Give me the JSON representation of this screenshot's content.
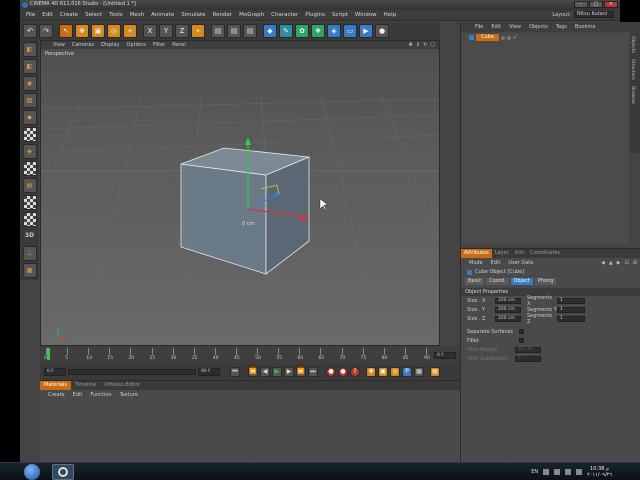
{
  "window": {
    "title": "CINEMA 4D R11.016 Studio - [Untitled 1 *]"
  },
  "menubar": [
    "File",
    "Edit",
    "Create",
    "Select",
    "Tools",
    "Mesh",
    "Animate",
    "Simulate",
    "Render",
    "MoGraph",
    "Character",
    "Plugins",
    "Script",
    "Window",
    "Help"
  ],
  "layout": {
    "label": "Layout:",
    "value": "Nitsu Kutani"
  },
  "viewport": {
    "menu": [
      "View",
      "Cameras",
      "Display",
      "Options",
      "Filter",
      "Panel"
    ],
    "label": "Perspective",
    "axis_readout": "0 cm"
  },
  "timeline": {
    "ticks": [
      "0",
      "5",
      "10",
      "15",
      "20",
      "25",
      "30",
      "35",
      "40",
      "45",
      "50",
      "55",
      "60",
      "65",
      "70",
      "75",
      "80",
      "85",
      "90"
    ],
    "end_frame": "0 F"
  },
  "transport": {
    "current": "0 F",
    "end": "90 F"
  },
  "materials": {
    "tabs": [
      "Materials",
      "Timeline",
      "XPresso Editor"
    ],
    "menu": [
      "Create",
      "Edit",
      "Function",
      "Texture"
    ]
  },
  "object_manager": {
    "menu": [
      "File",
      "Edit",
      "View",
      "Objects",
      "Tags",
      "Bookma"
    ],
    "objects": [
      {
        "name": "Cube"
      }
    ],
    "side_tabs": [
      "Objects",
      "Structure",
      "Browser"
    ]
  },
  "attributes": {
    "tabs": [
      "Attributes",
      "Layer",
      "Info",
      "Coordinates"
    ],
    "menu": [
      "Mode",
      "Edit",
      "User Data"
    ],
    "object_title": "Cube Object [Cube]",
    "subtabs": [
      "Basic",
      "Coord.",
      "Object",
      "Phong"
    ],
    "section": "Object Properties",
    "props": [
      {
        "label": "Size . X",
        "value": "200 cm",
        "label2": "Segments X",
        "value2": "1"
      },
      {
        "label": "Size . Y",
        "value": "200 cm",
        "label2": "Segments Y",
        "value2": "1"
      },
      {
        "label": "Size . Z",
        "value": "200 cm",
        "label2": "Segments Z",
        "value2": "1"
      }
    ],
    "separate_surfaces": "Separate Surfaces",
    "fillet": "Fillet",
    "fillet_radius": {
      "label": "Fillet Radius",
      "value": "40 cm"
    },
    "fillet_subdivision": {
      "label": "Fillet Subdivision",
      "value": "5"
    }
  },
  "taskbar": {
    "lang": "EN",
    "time": "10:38 م",
    "date": "٢٠١١/٠٩/٢٦"
  }
}
